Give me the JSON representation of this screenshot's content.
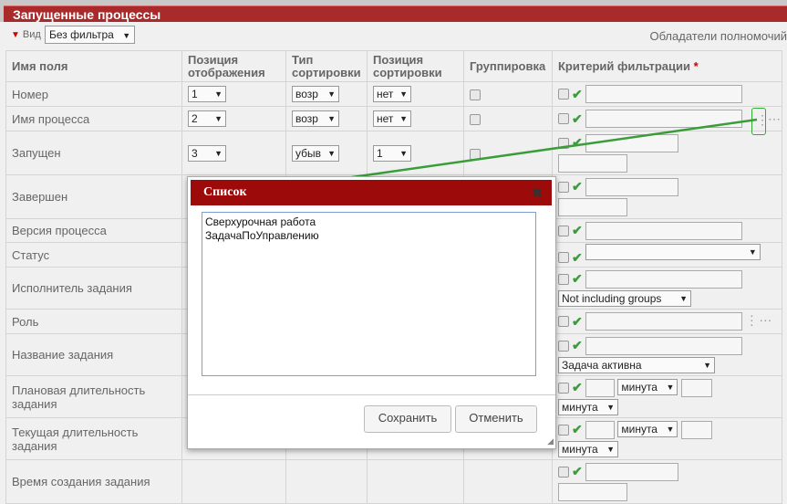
{
  "window": {
    "title": "Запущенные процессы"
  },
  "toolbar": {
    "view_label": "Вид",
    "filter_value": "Без фильтра",
    "owners_label": "Обладатели полномочий"
  },
  "table": {
    "headers": [
      "Имя поля",
      "Позиция отображения",
      "Тип сортировки",
      "Позиция сортировки",
      "Группировка",
      "Критерий фильтрации"
    ],
    "header_split": {
      "pos_display": [
        "Позиция",
        "отображения"
      ],
      "sort_type": [
        "Тип",
        "сортировки"
      ],
      "sort_pos": [
        "Позиция",
        "сортировки"
      ]
    },
    "required_mark": "*",
    "rows": [
      {
        "name": "Номер",
        "pos": "1",
        "sort": "возр",
        "sortpos": "нет"
      },
      {
        "name": "Имя процесса",
        "pos": "2",
        "sort": "возр",
        "sortpos": "нет"
      },
      {
        "name": "Запущен",
        "pos": "3",
        "sort": "убыв",
        "sortpos": "1"
      },
      {
        "name": "Завершен"
      },
      {
        "name": "Версия процесса"
      },
      {
        "name": "Статус"
      },
      {
        "name": "Исполнитель задания",
        "extra_select": "Not including groups"
      },
      {
        "name": "Роль"
      },
      {
        "name": "Название задания",
        "extra_select": "Задача активна"
      },
      {
        "name_line1": "Плановая длительность",
        "name_line2": "задания",
        "unit": "минута",
        "unit2": "минута"
      },
      {
        "name_line1": "Текущая длительность",
        "name_line2": "задания",
        "unit": "минута",
        "unit2": "минута"
      },
      {
        "name": "Время создания задания"
      }
    ]
  },
  "dialog": {
    "title": "Список",
    "close": "✖",
    "text": "Сверхурочная работа\nЗадачаПоУправлению",
    "save_label": "Сохранить",
    "cancel_label": "Отменить"
  },
  "colors": {
    "title_bg": "#a92a2a",
    "dialog_head": "#9d0a0a",
    "accent_green": "#3a9d3a"
  }
}
